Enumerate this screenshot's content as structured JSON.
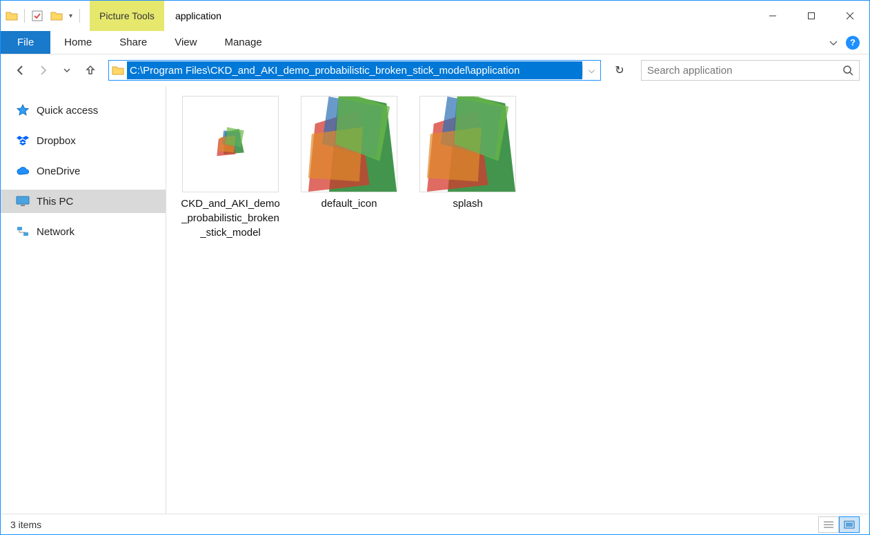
{
  "window": {
    "title": "application",
    "context_tab": "Picture Tools",
    "address_path": "C:\\Program Files\\CKD_and_AKI_demo_probabilistic_broken_stick_model\\application",
    "search_placeholder": "Search application"
  },
  "ribbon": {
    "file": "File",
    "tabs": [
      "Home",
      "Share",
      "View",
      "Manage"
    ]
  },
  "sidebar": {
    "items": [
      {
        "label": "Quick access",
        "icon": "star-icon",
        "selected": false
      },
      {
        "label": "Dropbox",
        "icon": "dropbox-icon",
        "selected": false
      },
      {
        "label": "OneDrive",
        "icon": "cloud-icon",
        "selected": false
      },
      {
        "label": "This PC",
        "icon": "monitor-icon",
        "selected": true
      },
      {
        "label": "Network",
        "icon": "network-icon",
        "selected": false
      }
    ]
  },
  "files": {
    "items": [
      {
        "name": "CKD_and_AKI_demo_probabilistic_broken_stick_model",
        "thumb": "shapes",
        "small": true
      },
      {
        "name": "default_icon",
        "thumb": "shapes",
        "small": false
      },
      {
        "name": "splash",
        "thumb": "shapes",
        "small": false
      }
    ]
  },
  "status": {
    "text": "3 items"
  }
}
